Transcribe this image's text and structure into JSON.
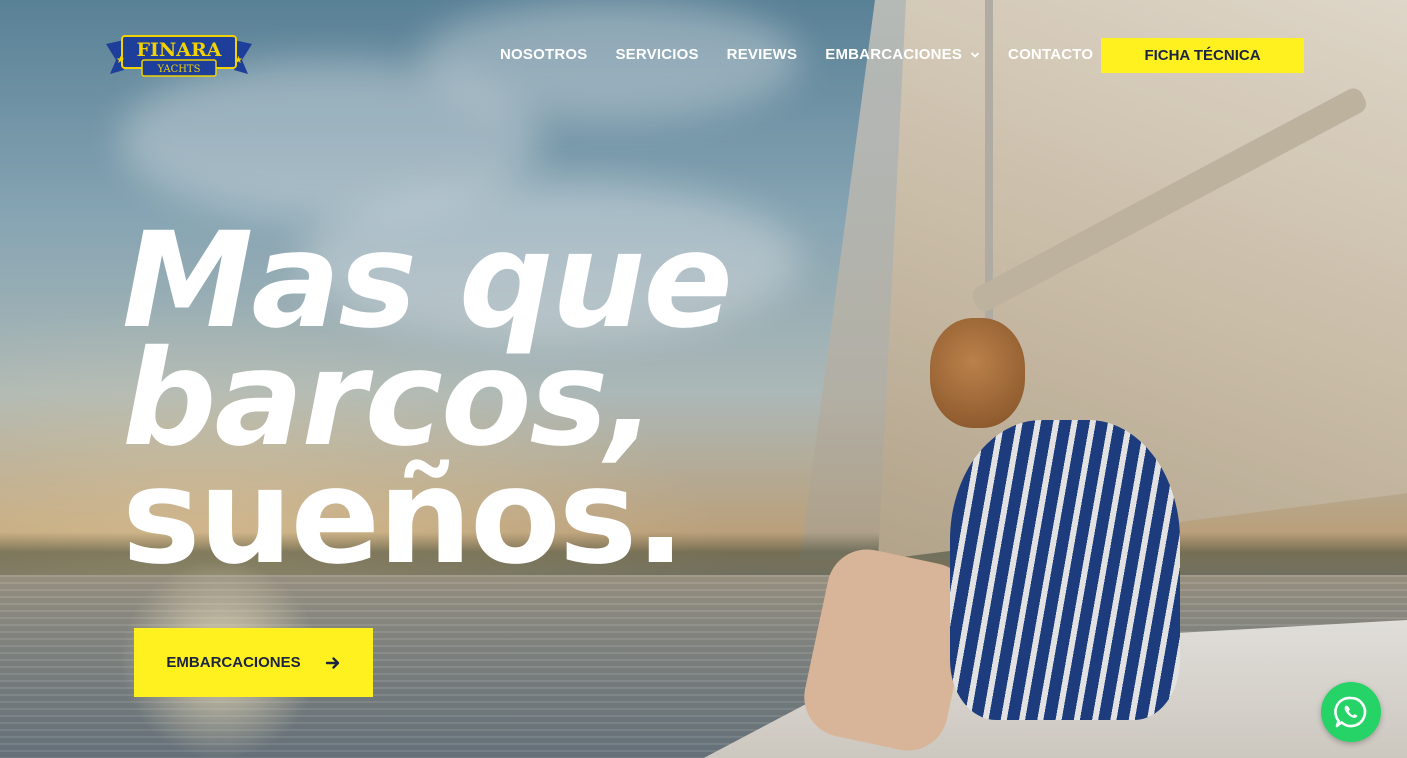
{
  "logo": {
    "title": "FINARA",
    "subtitle": "YACHTS"
  },
  "nav": {
    "items": [
      {
        "label": "NOSOTROS"
      },
      {
        "label": "SERVICIOS"
      },
      {
        "label": "REVIEWS"
      },
      {
        "label": "EMBARCACIONES",
        "has_dropdown": true,
        "icon": "chevron-down-icon"
      },
      {
        "label": "CONTACTO"
      }
    ],
    "cta_label": "FICHA TÉCNICA"
  },
  "hero": {
    "headline_line1": "Mas que",
    "headline_line2": "barcos,",
    "headline_line3": "sueños.",
    "button_label": "EMBARCACIONES",
    "button_icon": "arrow-right-icon"
  },
  "whatsapp": {
    "icon": "whatsapp-icon"
  },
  "colors": {
    "accent": "#fff11f",
    "button_text": "#1c2440",
    "logo_blue": "#1d3f9a",
    "logo_gold": "#f2d200",
    "whatsapp_green": "#25d366"
  }
}
